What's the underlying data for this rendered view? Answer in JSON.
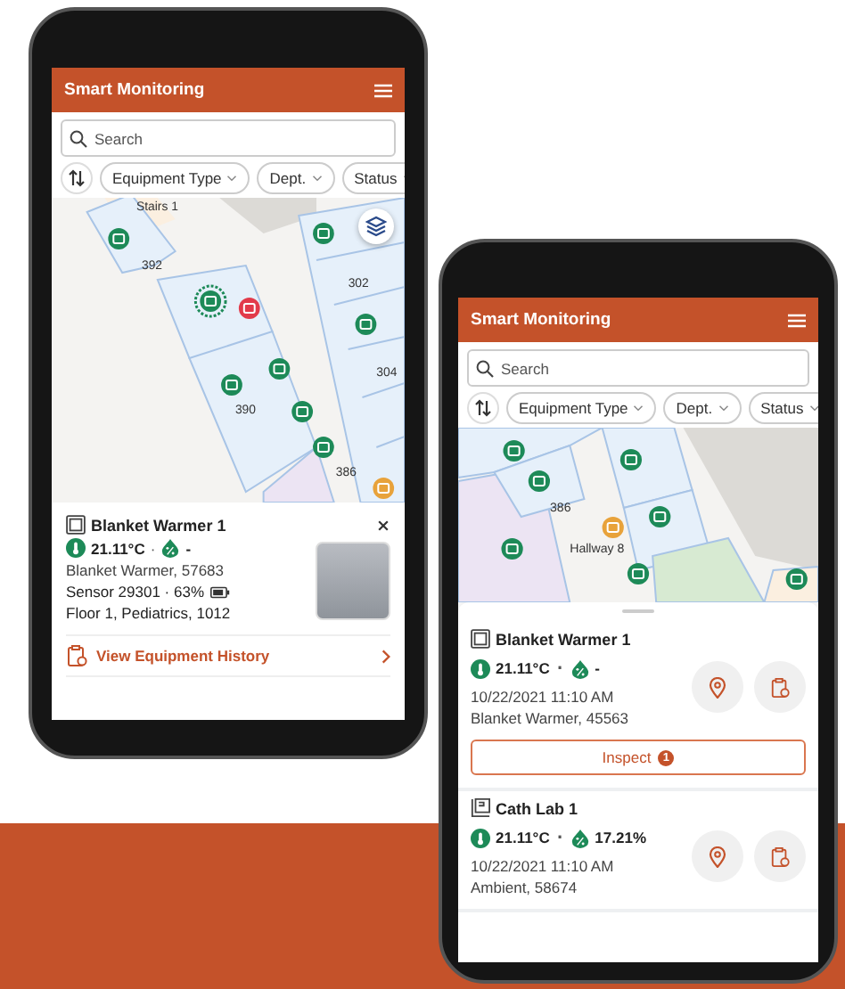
{
  "phones": [
    {
      "kind": "map_detail",
      "header": {
        "title": "Smart Monitoring"
      },
      "search": {
        "placeholder": "Search"
      },
      "filters": [
        "Equipment Type",
        "Dept.",
        "Status"
      ],
      "map": {
        "labels": [
          "Stairs 1",
          "392",
          "302",
          "304",
          "390",
          "386"
        ],
        "markers": [
          {
            "color": "#1d8a58",
            "selected": false
          },
          {
            "color": "#1d8a58",
            "selected": false
          },
          {
            "color": "#1d8a58",
            "selected": true
          },
          {
            "color": "#e23a4a",
            "selected": false
          },
          {
            "color": "#1d8a58",
            "selected": false
          },
          {
            "color": "#1d8a58",
            "selected": false
          },
          {
            "color": "#1d8a58",
            "selected": false
          },
          {
            "color": "#1d8a58",
            "selected": false
          },
          {
            "color": "#1d8a58",
            "selected": false
          },
          {
            "color": "#e8a23a",
            "selected": false
          }
        ]
      },
      "detail": {
        "name": "Blanket Warmer 1",
        "temperature": "21.11°C",
        "separator": "·",
        "humidity": "-",
        "description": "Blanket Warmer, 57683",
        "sensor": "Sensor 29301 · 63%",
        "location": "Floor 1, Pediatrics, 1012",
        "link": "View Equipment History"
      }
    },
    {
      "kind": "list",
      "header": {
        "title": "Smart Monitoring"
      },
      "search": {
        "placeholder": "Search"
      },
      "filters": [
        "Equipment Type",
        "Dept.",
        "Status"
      ],
      "map": {
        "labels": [
          "386",
          "Hallway 8"
        ],
        "markers": [
          {
            "color": "#1d8a58",
            "selected": false
          },
          {
            "color": "#1d8a58",
            "selected": false
          },
          {
            "color": "#1d8a58",
            "selected": false
          },
          {
            "color": "#1d8a58",
            "selected": false
          },
          {
            "color": "#e8a23a",
            "selected": false
          },
          {
            "color": "#1d8a58",
            "selected": false
          },
          {
            "color": "#1d8a58",
            "selected": false
          },
          {
            "color": "#1d8a58",
            "selected": false
          }
        ]
      },
      "list": [
        {
          "kind": "warmer",
          "name": "Blanket Warmer 1",
          "temperature": "21.11°C",
          "separator": "·",
          "humidity": "-",
          "timestamp": "10/22/2021 11:10 AM",
          "description": "Blanket Warmer, 45563",
          "inspect": {
            "label": "Inspect",
            "count": "1"
          }
        },
        {
          "kind": "cath_lab",
          "name": "Cath Lab 1",
          "temperature": "21.11°C",
          "separator": "·",
          "humidity": "17.21%",
          "timestamp": "10/22/2021 11:10 AM",
          "description": "Ambient, 58674"
        }
      ]
    }
  ]
}
